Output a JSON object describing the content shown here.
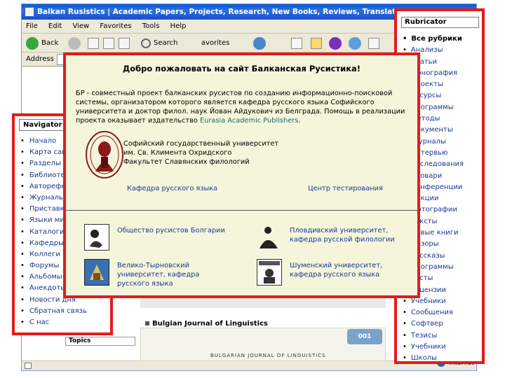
{
  "window": {
    "title": "Balkan Rusistics | Academic Papers, Projects, Research, New Books, Reviews, Translations - Microsoft Int"
  },
  "menu": [
    "File",
    "Edit",
    "View",
    "Favorites",
    "Tools",
    "Help"
  ],
  "toolbar": {
    "back": "Back",
    "search": "Search",
    "favorites": "avorites"
  },
  "addressbar": {
    "label": "Address"
  },
  "navigator": {
    "title": "Navigator",
    "items": [
      "Начало",
      "Карта сайта",
      "Разделы",
      "Библиотека",
      "Авторефераты",
      "Журналы",
      "Приставки",
      "Языки мира",
      "Каталоги",
      "Кафедры",
      "Коллеги",
      "Форумы",
      "Альбомы",
      "Анекдоты",
      "Новости дня",
      "Сбратная связь",
      "С нас"
    ]
  },
  "rubricator": {
    "title": "Rubricator",
    "items": [
      "Все рубрики",
      "Анализы",
      "Статьи",
      "Монография",
      "Проекты",
      "Ресурсы",
      "Программы",
      "Методы",
      "Документы",
      "Журналы",
      "Интервью",
      "Исследования",
      "Словари",
      "Конференции",
      "Лекции",
      "Фотографии",
      "Тексты",
      "Новые книги",
      "Обзоры",
      "Рассказы",
      "Программы",
      "Тесты",
      "Рецензии",
      "Учебники",
      "Сообщения",
      "Софтвер",
      "Тезисы",
      "Учебники",
      "Школы"
    ]
  },
  "welcome": {
    "title": "Добро пожаловать на сайт Балканская Русистика!",
    "desc_main": "БР - совместный проект балканских русистов по созданию информационно-поисковой системы, организатором которого является кафедра русского языка Софийского университета и доктор филол. наук Йован Айдукович из Белграда. Помощь в реализации проекта оказывает издательство ",
    "desc_link": "Eurasia Academic Publishers",
    "desc_end": ".",
    "univ_line1": "Софийский государственный университет",
    "univ_line2": "им. Св. Климента Охридского",
    "univ_line3": "Факультет Славянских филологий",
    "seal_text": "SOFIA UNIVERSITAS",
    "dept": "Кафедра русского языка",
    "test": "Центр тестирования",
    "partners": {
      "p1": "Общество русистов Болгарии",
      "p2_l1": "Пловдивский университет,",
      "p2_l2": "кафедра русской филологии",
      "p3_l1": "Велико-Тырновский",
      "p3_l2": "университет, кафедра",
      "p3_l3": "русского языка",
      "p4_l1": "Шуменский университет,",
      "p4_l2": "кафедра русского языка"
    }
  },
  "background": {
    "journal": "Bulgian Journal of Linguistics",
    "topics": "Topics",
    "badge": "001",
    "footer": "BULGARIAN JOURNAL OF LINGUISTICS",
    "edge_text": "Internet"
  },
  "colors": {
    "highlight_border": "#e21c1c",
    "welcome_bg": "#f5f5dc",
    "link": "#1a3a8a",
    "titlebar": "#0a5bd6"
  }
}
